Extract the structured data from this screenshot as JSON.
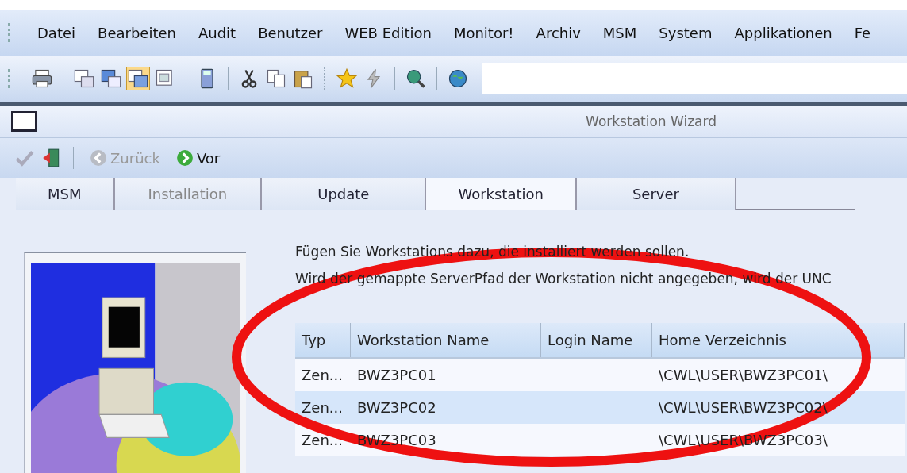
{
  "menu_bar": {
    "items": [
      "Datei",
      "Bearbeiten",
      "Audit",
      "Benutzer",
      "WEB Edition",
      "Monitor!",
      "Archiv",
      "MSM",
      "System",
      "Applikationen",
      "Fe"
    ]
  },
  "window": {
    "title": "Workstation Wizard"
  },
  "wizard_toolbar": {
    "buttons": [
      {
        "label": "Zurück",
        "disabled": true
      },
      {
        "label": "Vor",
        "disabled": false
      }
    ]
  },
  "tabs": [
    {
      "label": "MSM",
      "selected": false,
      "disabled": false
    },
    {
      "label": "Installation",
      "selected": false,
      "disabled": true
    },
    {
      "label": "Update",
      "selected": false,
      "disabled": false
    },
    {
      "label": "Workstation",
      "selected": true,
      "disabled": false
    },
    {
      "label": "Server",
      "selected": false,
      "disabled": false
    }
  ],
  "instructions": [
    "Fügen Sie Workstations dazu, die installiert werden sollen.",
    "Wird der gemappte ServerPfad der Workstation nicht angegeben, wird der UNC"
  ],
  "table": {
    "columns": [
      "Typ",
      "Workstation Name",
      "Login Name",
      "Home Verzeichnis"
    ],
    "rows": [
      [
        "Zen...",
        "BWZ3PC01",
        "",
        "\\CWL\\USER\\BWZ3PC01\\"
      ],
      [
        "Zen...",
        "BWZ3PC02",
        "",
        "\\CWL\\USER\\BWZ3PC02\\"
      ],
      [
        "Zen...",
        "BWZ3PC03",
        "",
        "\\CWL\\USER\\BWZ3PC03\\"
      ]
    ]
  }
}
